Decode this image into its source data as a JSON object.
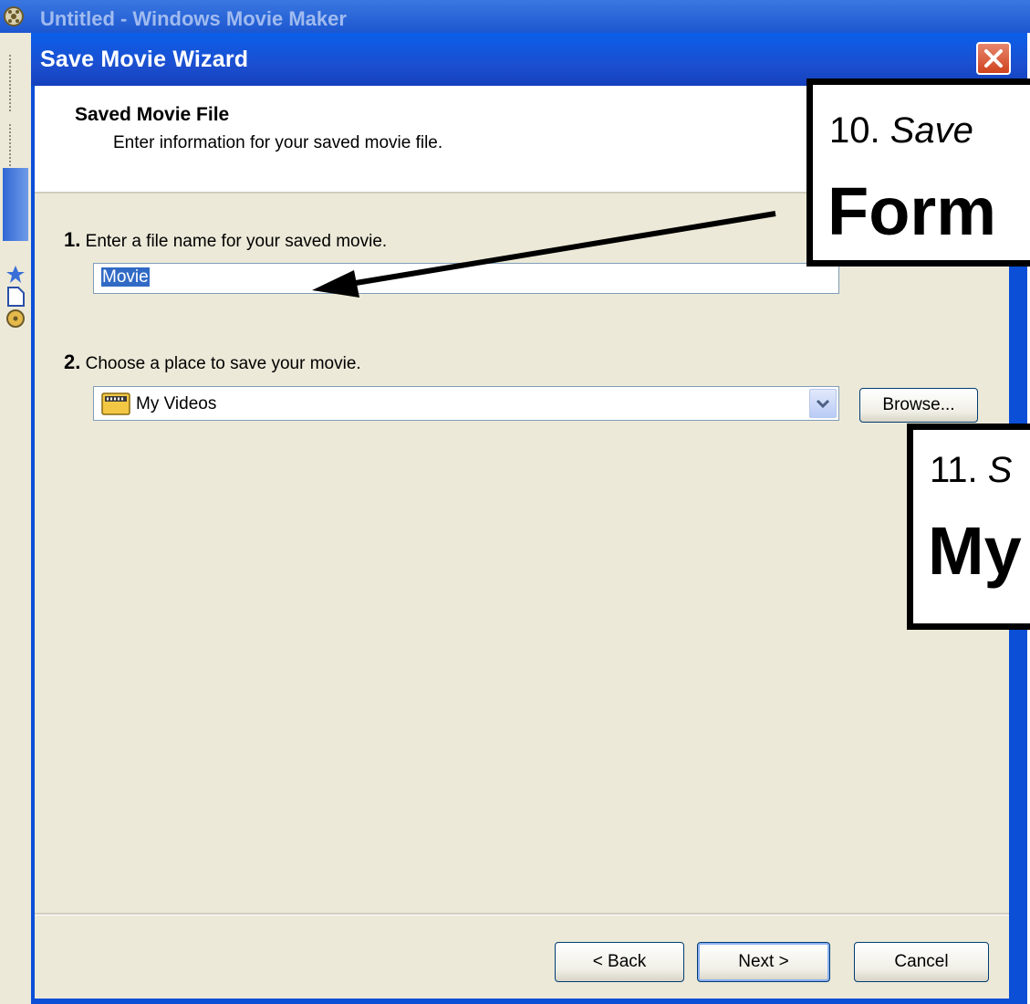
{
  "parent_window": {
    "title": "Untitled - Windows Movie Maker"
  },
  "dialog": {
    "title": "Save Movie Wizard",
    "header": {
      "title": "Saved Movie File",
      "subtitle": "Enter information for your saved movie file."
    },
    "step1": {
      "number": "1.",
      "label": "Enter a file name for your saved movie.",
      "filename_value": "Movie"
    },
    "step2": {
      "number": "2.",
      "label": "Choose a place to save your movie.",
      "location_value": "My Videos",
      "browse_label": "Browse..."
    },
    "buttons": {
      "back": "< Back",
      "next": "Next >",
      "cancel": "Cancel"
    }
  },
  "annotations": {
    "callout1": {
      "step": "10.",
      "action": "Save",
      "bold": "Form"
    },
    "callout2": {
      "step": "11.",
      "action": "S",
      "bold": "My"
    }
  }
}
